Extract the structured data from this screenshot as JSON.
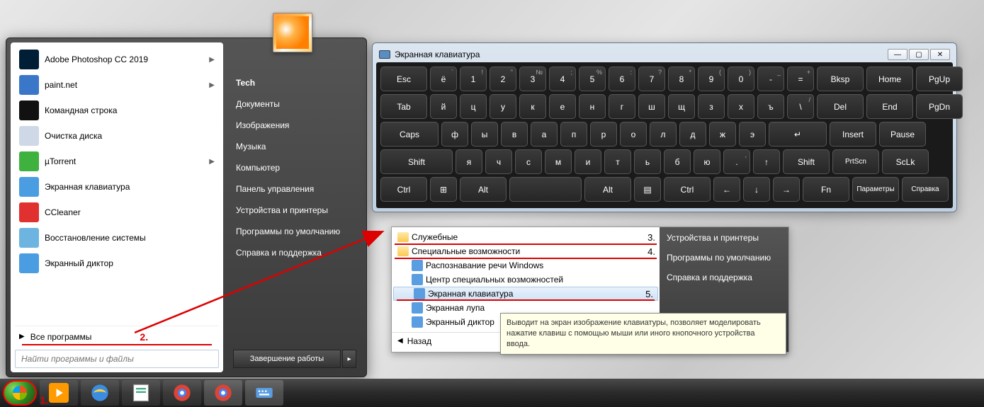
{
  "start_menu": {
    "apps": [
      {
        "label": "Adobe Photoshop CC 2019",
        "color": "#001e36",
        "arrow": true
      },
      {
        "label": "paint.net",
        "color": "#3a77c8",
        "arrow": true
      },
      {
        "label": "Командная строка",
        "color": "#111",
        "arrow": false
      },
      {
        "label": "Очистка диска",
        "color": "#cfd8e6",
        "arrow": false
      },
      {
        "label": "µTorrent",
        "color": "#3fb13f",
        "arrow": true
      },
      {
        "label": "Экранная клавиатура",
        "color": "#4a9de0",
        "arrow": false
      },
      {
        "label": "CCleaner",
        "color": "#e03030",
        "arrow": false
      },
      {
        "label": "Восстановление системы",
        "color": "#6db4e0",
        "arrow": false
      },
      {
        "label": "Экранный диктор",
        "color": "#4a9de0",
        "arrow": false
      }
    ],
    "all_programs": "Все программы",
    "step2": "2.",
    "search_placeholder": "Найти программы и файлы",
    "right": {
      "user": "Tech",
      "items": [
        "Документы",
        "Изображения",
        "Музыка",
        "Компьютер",
        "Панель управления",
        "Устройства и принтеры",
        "Программы по умолчанию",
        "Справка и поддержка"
      ],
      "shutdown": "Завершение работы"
    }
  },
  "osk": {
    "title": "Экранная клавиатура",
    "rows": [
      [
        {
          "t": "Esc",
          "w": "wide1"
        },
        {
          "t": "ё",
          "sup": "`"
        },
        {
          "t": "1",
          "sup": "!"
        },
        {
          "t": "2",
          "sup": "\""
        },
        {
          "t": "3",
          "sup": "№"
        },
        {
          "t": "4",
          "sup": ";"
        },
        {
          "t": "5",
          "sup": "%"
        },
        {
          "t": "6",
          "sup": ":"
        },
        {
          "t": "7",
          "sup": "?"
        },
        {
          "t": "8",
          "sup": "*"
        },
        {
          "t": "9",
          "sup": "("
        },
        {
          "t": "0",
          "sup": ")"
        },
        {
          "t": "-",
          "sup": "_"
        },
        {
          "t": "=",
          "sup": "+"
        },
        {
          "t": "Bksp",
          "w": "wide1"
        },
        {
          "t": "Home",
          "w": "wide1"
        },
        {
          "t": "PgUp",
          "w": "wide1"
        }
      ],
      [
        {
          "t": "Tab",
          "w": "wide1"
        },
        {
          "t": "й"
        },
        {
          "t": "ц"
        },
        {
          "t": "у"
        },
        {
          "t": "к"
        },
        {
          "t": "е"
        },
        {
          "t": "н"
        },
        {
          "t": "г"
        },
        {
          "t": "ш"
        },
        {
          "t": "щ"
        },
        {
          "t": "з"
        },
        {
          "t": "х"
        },
        {
          "t": "ъ"
        },
        {
          "t": "\\",
          "sup": "/"
        },
        {
          "t": "Del",
          "w": "wide1"
        },
        {
          "t": "End",
          "w": "wide1"
        },
        {
          "t": "PgDn",
          "w": "wide1"
        }
      ],
      [
        {
          "t": "Caps",
          "w": "wide2"
        },
        {
          "t": "ф"
        },
        {
          "t": "ы"
        },
        {
          "t": "в"
        },
        {
          "t": "а"
        },
        {
          "t": "п"
        },
        {
          "t": "р"
        },
        {
          "t": "о"
        },
        {
          "t": "л"
        },
        {
          "t": "д"
        },
        {
          "t": "ж"
        },
        {
          "t": "э"
        },
        {
          "t": "↵",
          "w": "wide2"
        },
        {
          "t": "Insert",
          "w": "wide1"
        },
        {
          "t": "Pause",
          "w": "wide1"
        }
      ],
      [
        {
          "t": "Shift",
          "w": "wide3"
        },
        {
          "t": "я"
        },
        {
          "t": "ч"
        },
        {
          "t": "с"
        },
        {
          "t": "м"
        },
        {
          "t": "и"
        },
        {
          "t": "т"
        },
        {
          "t": "ь"
        },
        {
          "t": "б"
        },
        {
          "t": "ю"
        },
        {
          "t": ".",
          "sup": ","
        },
        {
          "t": "↑"
        },
        {
          "t": "Shift",
          "w": "wide1"
        },
        {
          "t": "PrtScn",
          "w": "wide1",
          "s": true
        },
        {
          "t": "ScLk",
          "w": "wide1"
        }
      ],
      [
        {
          "t": "Ctrl",
          "w": "wide1"
        },
        {
          "t": "⊞"
        },
        {
          "t": "Alt",
          "w": "wide1"
        },
        {
          "t": "",
          "w": "space"
        },
        {
          "t": "Alt",
          "w": "wide1"
        },
        {
          "t": "▤"
        },
        {
          "t": "Ctrl",
          "w": "wide1"
        },
        {
          "t": "←"
        },
        {
          "t": "↓"
        },
        {
          "t": "→"
        },
        {
          "t": "Fn",
          "w": "wide1"
        },
        {
          "t": "Параметры",
          "w": "wide1",
          "s": true
        },
        {
          "t": "Справка",
          "w": "wide1",
          "s": true
        }
      ]
    ]
  },
  "submenu": {
    "items": [
      {
        "label": "Служебные",
        "type": "folder",
        "underline": true,
        "step": "3."
      },
      {
        "label": "Специальные возможности",
        "type": "folder",
        "underline": true,
        "step": "4."
      },
      {
        "label": "Распознавание речи Windows",
        "type": "tool",
        "indent": true
      },
      {
        "label": "Центр специальных возможностей",
        "type": "tool",
        "indent": true
      },
      {
        "label": "Экранная клавиатура",
        "type": "tool",
        "indent": true,
        "selected": true,
        "underline": true,
        "step": "5."
      },
      {
        "label": "Экранная лупа",
        "type": "tool",
        "indent": true
      },
      {
        "label": "Экранный диктор",
        "type": "tool",
        "indent": true
      }
    ],
    "back": "Назад",
    "right": [
      "Устройства и принтеры",
      "Программы по умолчанию",
      "Справка и поддержка"
    ]
  },
  "tooltip": "Выводит на экран изображение клавиатуры, позволяет моделировать нажатие клавиш с помощью мыши или иного кнопочного устройства ввода.",
  "step1": "1."
}
